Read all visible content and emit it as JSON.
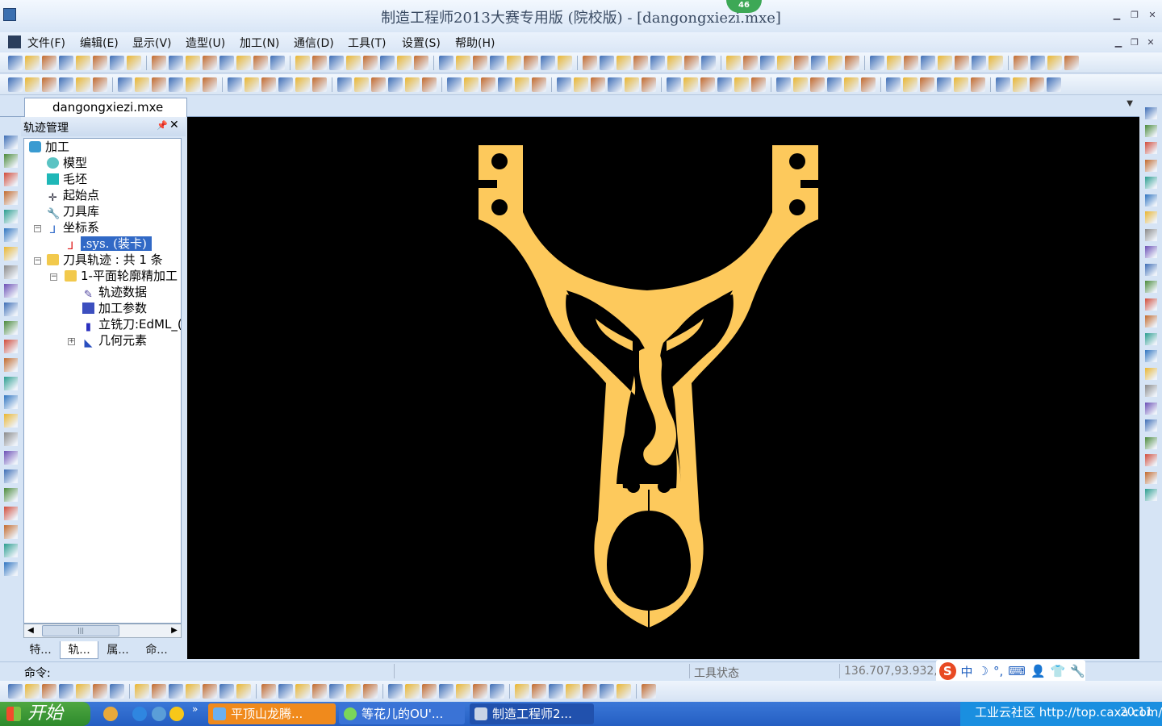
{
  "window": {
    "title": "制造工程师2013大赛专用版 (院校版) - [dangongxiezi.mxe]",
    "badge": "46"
  },
  "menu": [
    "文件(F)",
    "编辑(E)",
    "显示(V)",
    "造型(U)",
    "加工(N)",
    "通信(D)",
    "工具(T)",
    "设置(S)",
    "帮助(H)"
  ],
  "document_tab": "dangongxiezi.mxe",
  "panel": {
    "title": "轨迹管理",
    "tree": [
      {
        "label": "加工",
        "icon": "machining-icon"
      },
      {
        "label": "模型",
        "icon": "model-icon"
      },
      {
        "label": "毛坯",
        "icon": "blank-stock-icon"
      },
      {
        "label": "起始点",
        "icon": "start-point-icon"
      },
      {
        "label": "刀具库",
        "icon": "tool-library-icon"
      },
      {
        "label": "坐标系",
        "icon": "coordinate-system-icon"
      },
      {
        "label": ".sys. (装卡)",
        "icon": "axis-icon",
        "selected": true
      },
      {
        "label": "刀具轨迹 : 共 1 条",
        "icon": "folder-icon"
      },
      {
        "label": "1-平面轮廓精加工",
        "icon": "folder-open-icon"
      },
      {
        "label": "轨迹数据",
        "icon": "trajectory-data-icon"
      },
      {
        "label": "加工参数",
        "icon": "parameters-icon"
      },
      {
        "label": "立铣刀:EdML_(",
        "icon": "end-mill-icon"
      },
      {
        "label": "几何元素",
        "icon": "geometry-icon"
      }
    ],
    "tabs": [
      "特...",
      "轨...",
      "属...",
      "命..."
    ],
    "active_tab": 1
  },
  "status": {
    "command_label": "命令:",
    "tool_status": "工具状态",
    "coordinates": "136.707,93.932,0"
  },
  "ime": {
    "logo": "S",
    "items": [
      "中",
      "☽",
      "°,",
      "⌨",
      "👤",
      "👕",
      "🔧"
    ]
  },
  "taskbar": {
    "start": "开始",
    "tasks": [
      {
        "label": "平顶山龙腾...",
        "color": "#f08a1c"
      },
      {
        "label": "等花儿的OU'...",
        "color": "#3a73d6"
      },
      {
        "label": "制造工程师2...",
        "color": "#2151ad"
      }
    ],
    "tray_text": "工业云社区 http://top.caxa.com/",
    "clock": "20:11"
  },
  "colors": {
    "canvas": "#000000",
    "part": "#fdc95c",
    "selection": "#3169c6"
  }
}
